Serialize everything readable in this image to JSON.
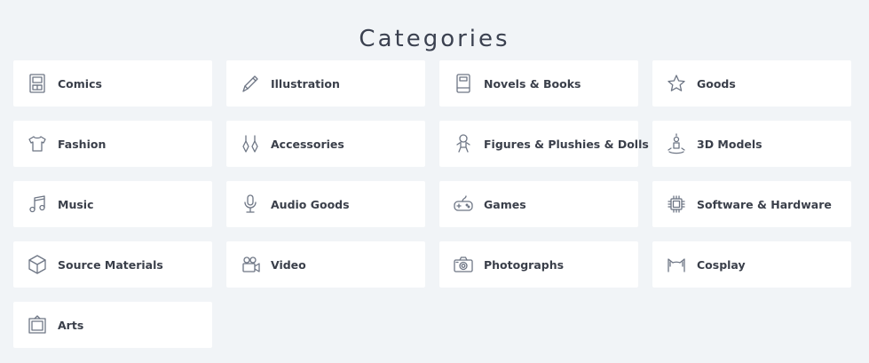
{
  "page": {
    "title": "Categories"
  },
  "categories": [
    {
      "label": "Comics",
      "icon": "comics-icon"
    },
    {
      "label": "Illustration",
      "icon": "pencil-icon"
    },
    {
      "label": "Novels & Books",
      "icon": "book-icon"
    },
    {
      "label": "Goods",
      "icon": "star-icon"
    },
    {
      "label": "Fashion",
      "icon": "tshirt-icon"
    },
    {
      "label": "Accessories",
      "icon": "earrings-icon"
    },
    {
      "label": "Figures & Plushies & Dolls",
      "icon": "doll-icon"
    },
    {
      "label": "3D Models",
      "icon": "3d-figure-icon"
    },
    {
      "label": "Music",
      "icon": "music-note-icon"
    },
    {
      "label": "Audio Goods",
      "icon": "microphone-icon"
    },
    {
      "label": "Games",
      "icon": "gamepad-icon"
    },
    {
      "label": "Software & Hardware",
      "icon": "chip-icon"
    },
    {
      "label": "Source Materials",
      "icon": "cube-icon"
    },
    {
      "label": "Video",
      "icon": "video-camera-icon"
    },
    {
      "label": "Photographs",
      "icon": "camera-icon"
    },
    {
      "label": "Cosplay",
      "icon": "cat-ears-icon"
    },
    {
      "label": "Arts",
      "icon": "picture-frame-icon"
    }
  ]
}
